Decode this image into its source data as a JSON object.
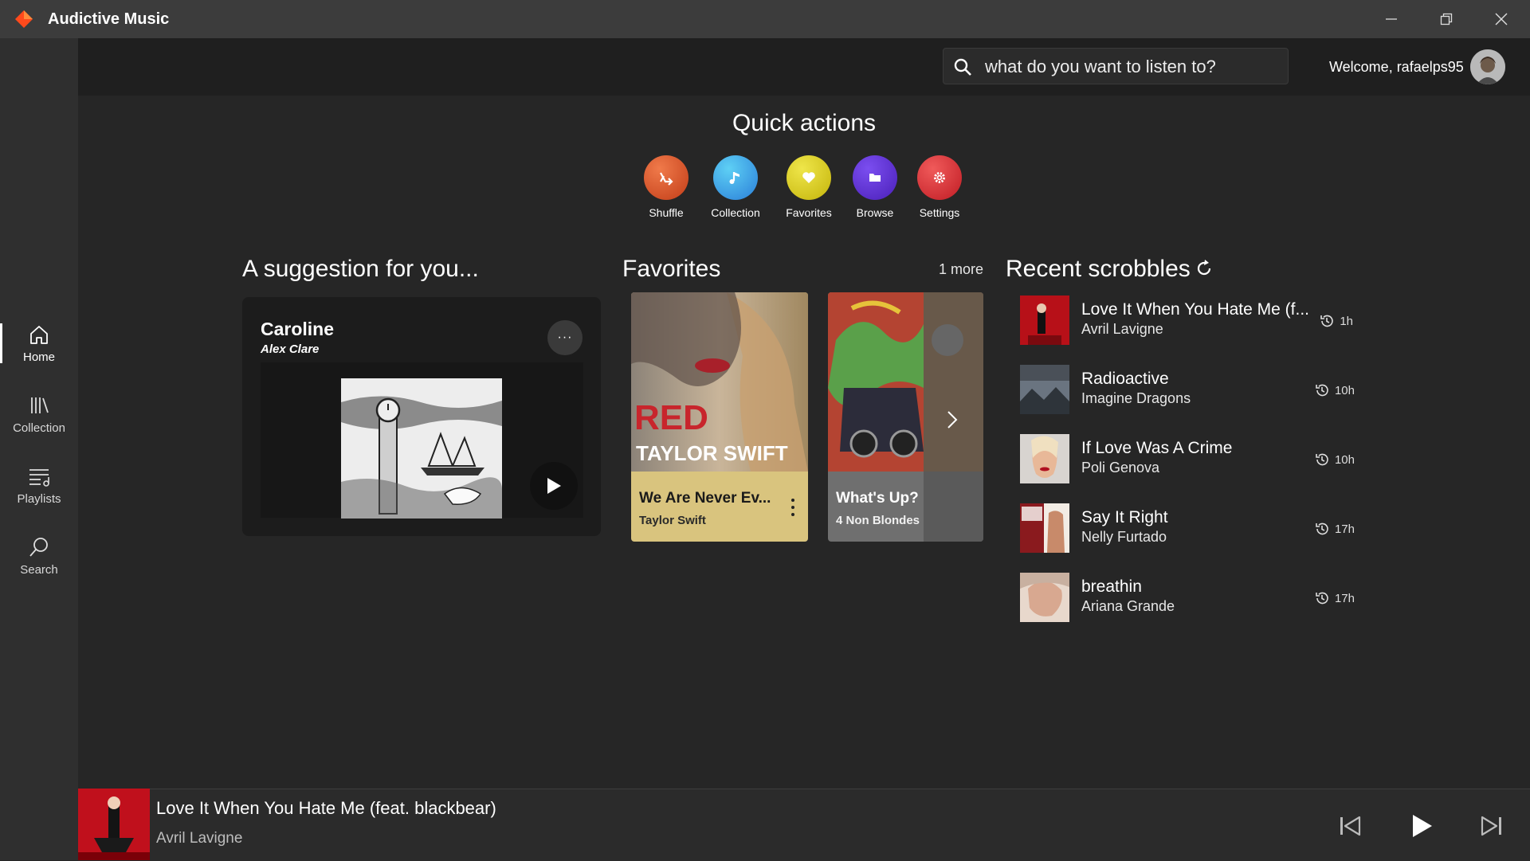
{
  "app": {
    "title": "Audictive Music"
  },
  "window_controls": [
    "minimize-icon",
    "restore-icon",
    "close-icon"
  ],
  "sidebar": {
    "items": [
      {
        "label": "Home",
        "icon": "home-icon",
        "active": true
      },
      {
        "label": "Collection",
        "icon": "library-icon"
      },
      {
        "label": "Playlists",
        "icon": "playlist-icon"
      },
      {
        "label": "Search",
        "icon": "search-icon"
      }
    ]
  },
  "header": {
    "search": {
      "placeholder": "what do you want to listen to?"
    },
    "welcome": "Welcome, rafaelps95"
  },
  "quick_actions": {
    "title": "Quick actions",
    "items": [
      {
        "label": "Shuffle",
        "icon": "shuffle-icon",
        "color": "#d8542a"
      },
      {
        "label": "Collection",
        "icon": "music-note-icon",
        "color": "#3c9fe0"
      },
      {
        "label": "Favorites",
        "icon": "heart-icon",
        "color": "#d4c80f"
      },
      {
        "label": "Browse",
        "icon": "folder-icon",
        "color": "#5b2fd0"
      },
      {
        "label": "Settings",
        "icon": "gear-icon",
        "color": "#d42a32"
      }
    ]
  },
  "suggestion": {
    "heading": "A suggestion for you...",
    "title": "Caroline",
    "artist": "Alex Clare",
    "more_label": "···"
  },
  "favorites": {
    "heading": "Favorites",
    "more": "1 more",
    "cards": [
      {
        "title": "We Are Never Ev...",
        "artist": "Taylor Swift",
        "cover_text_1": "RED",
        "cover_text_2": "TAYLOR SWIFT",
        "color": "#d8c07a"
      },
      {
        "title": "What's Up?",
        "artist": "4 Non Blondes",
        "color": "#7a7a7a"
      }
    ]
  },
  "recent": {
    "heading": "Recent scrobbles",
    "items": [
      {
        "title": "Love It When You Hate Me (f...",
        "artist": "Avril Lavigne",
        "time": "1h"
      },
      {
        "title": "Radioactive",
        "artist": "Imagine Dragons",
        "time": "10h"
      },
      {
        "title": "If Love Was A Crime",
        "artist": "Poli Genova",
        "time": "10h"
      },
      {
        "title": "Say It Right",
        "artist": "Nelly Furtado",
        "time": "17h"
      },
      {
        "title": "breathin",
        "artist": "Ariana Grande",
        "time": "17h"
      }
    ]
  },
  "now_playing": {
    "title": "Love It When You Hate Me (feat. blackbear)",
    "artist": "Avril Lavigne"
  }
}
